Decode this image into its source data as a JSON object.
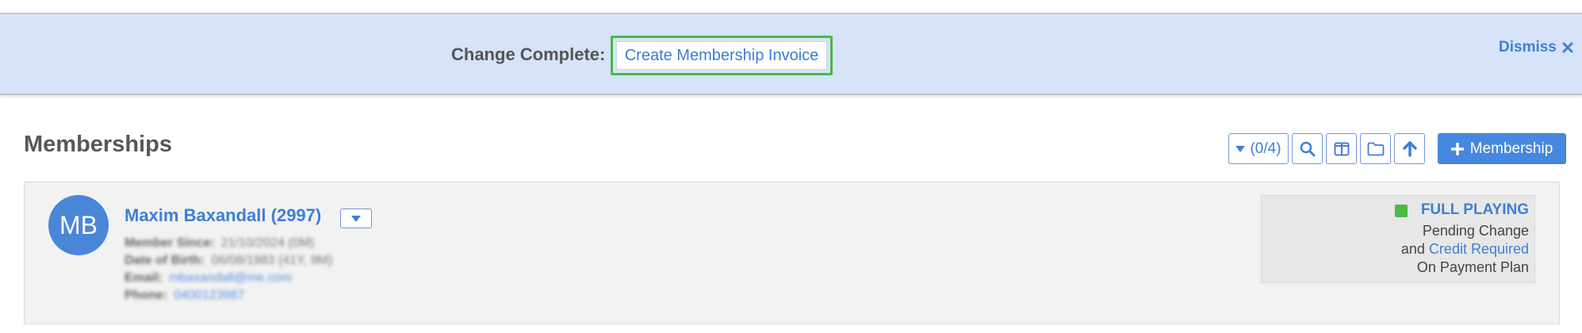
{
  "notice": {
    "label": "Change Complete:",
    "action": "Create Membership Invoice",
    "dismiss": "Dismiss"
  },
  "section": {
    "title": "Memberships"
  },
  "toolbar": {
    "filter_count": "(0/4)",
    "add_membership": "Membership"
  },
  "member": {
    "initials": "MB",
    "name": "Maxim Baxandall (2997)",
    "details": [
      {
        "key": "Member Since:",
        "value": "21/10/2024 (0M)"
      },
      {
        "key": "Date of Birth:",
        "value": "06/08/1983 (41Y, 9M)"
      },
      {
        "key": "Email:",
        "value": "mbaxandall@me.com"
      },
      {
        "key": "Phone:",
        "value": "0400123987"
      }
    ]
  },
  "status": {
    "title": "FULL PLAYING",
    "line1": "Pending Change",
    "line2_prefix": "and",
    "line2_link": "Credit Required",
    "line3": "On Payment Plan"
  },
  "colors": {
    "accent": "#3f7fd5",
    "notice_bg": "#d6e3f8",
    "status_green": "#4bb94a",
    "highlight_border": "#4cb748"
  }
}
